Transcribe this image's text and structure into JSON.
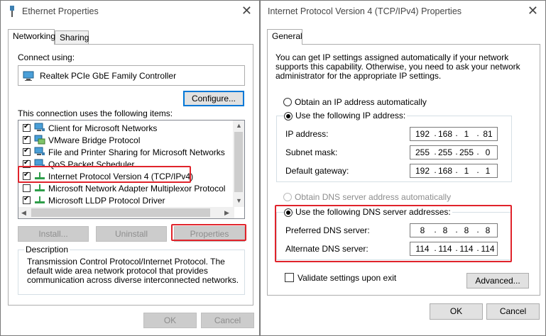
{
  "ethernet": {
    "title": "Ethernet Properties",
    "tabs": [
      "Networking",
      "Sharing"
    ],
    "connect_using_label": "Connect using:",
    "adapter": "Realtek PCIe GbE Family Controller",
    "configure_btn": "Configure...",
    "items_label": "This connection uses the following items:",
    "items": [
      {
        "label": "Client for Microsoft Networks",
        "checked": true,
        "icon": "network-client-icon"
      },
      {
        "label": "VMware Bridge Protocol",
        "checked": true,
        "icon": "network-service-icon"
      },
      {
        "label": "File and Printer Sharing for Microsoft Networks",
        "checked": true,
        "icon": "network-client-icon"
      },
      {
        "label": "QoS Packet Scheduler",
        "checked": true,
        "icon": "network-client-icon"
      },
      {
        "label": "Internet Protocol Version 4 (TCP/IPv4)",
        "checked": true,
        "icon": "protocol-icon"
      },
      {
        "label": "Microsoft Network Adapter Multiplexor Protocol",
        "checked": false,
        "icon": "protocol-icon"
      },
      {
        "label": "Microsoft LLDP Protocol Driver",
        "checked": true,
        "icon": "protocol-icon"
      }
    ],
    "install_btn": "Install...",
    "uninstall_btn": "Uninstall",
    "properties_btn": "Properties",
    "description_label": "Description",
    "description_text": "Transmission Control Protocol/Internet Protocol. The default wide area network protocol that provides communication across diverse interconnected networks.",
    "ok_btn": "OK",
    "cancel_btn": "Cancel"
  },
  "ipv4": {
    "title": "Internet Protocol Version 4 (TCP/IPv4) Properties",
    "tab": "General",
    "intro": "You can get IP settings assigned automatically if your network supports this capability. Otherwise, you need to ask your network administrator for the appropriate IP settings.",
    "obtain_ip_auto": "Obtain an IP address automatically",
    "use_following_ip": "Use the following IP address:",
    "ip_address_label": "IP address:",
    "ip_address": [
      "192",
      "168",
      "1",
      "81"
    ],
    "subnet_label": "Subnet mask:",
    "subnet": [
      "255",
      "255",
      "255",
      "0"
    ],
    "gateway_label": "Default gateway:",
    "gateway": [
      "192",
      "168",
      "1",
      "1"
    ],
    "obtain_dns_auto": "Obtain DNS server address automatically",
    "use_following_dns": "Use the following DNS server addresses:",
    "preferred_dns_label": "Preferred DNS server:",
    "preferred_dns": [
      "8",
      "8",
      "8",
      "8"
    ],
    "alternate_dns_label": "Alternate DNS server:",
    "alternate_dns": [
      "114",
      "114",
      "114",
      "114"
    ],
    "validate_label": "Validate settings upon exit",
    "advanced_btn": "Advanced...",
    "ok_btn": "OK",
    "cancel_btn": "Cancel"
  },
  "colors": {
    "highlight": "#e0232b",
    "focus": "#0078d7"
  }
}
